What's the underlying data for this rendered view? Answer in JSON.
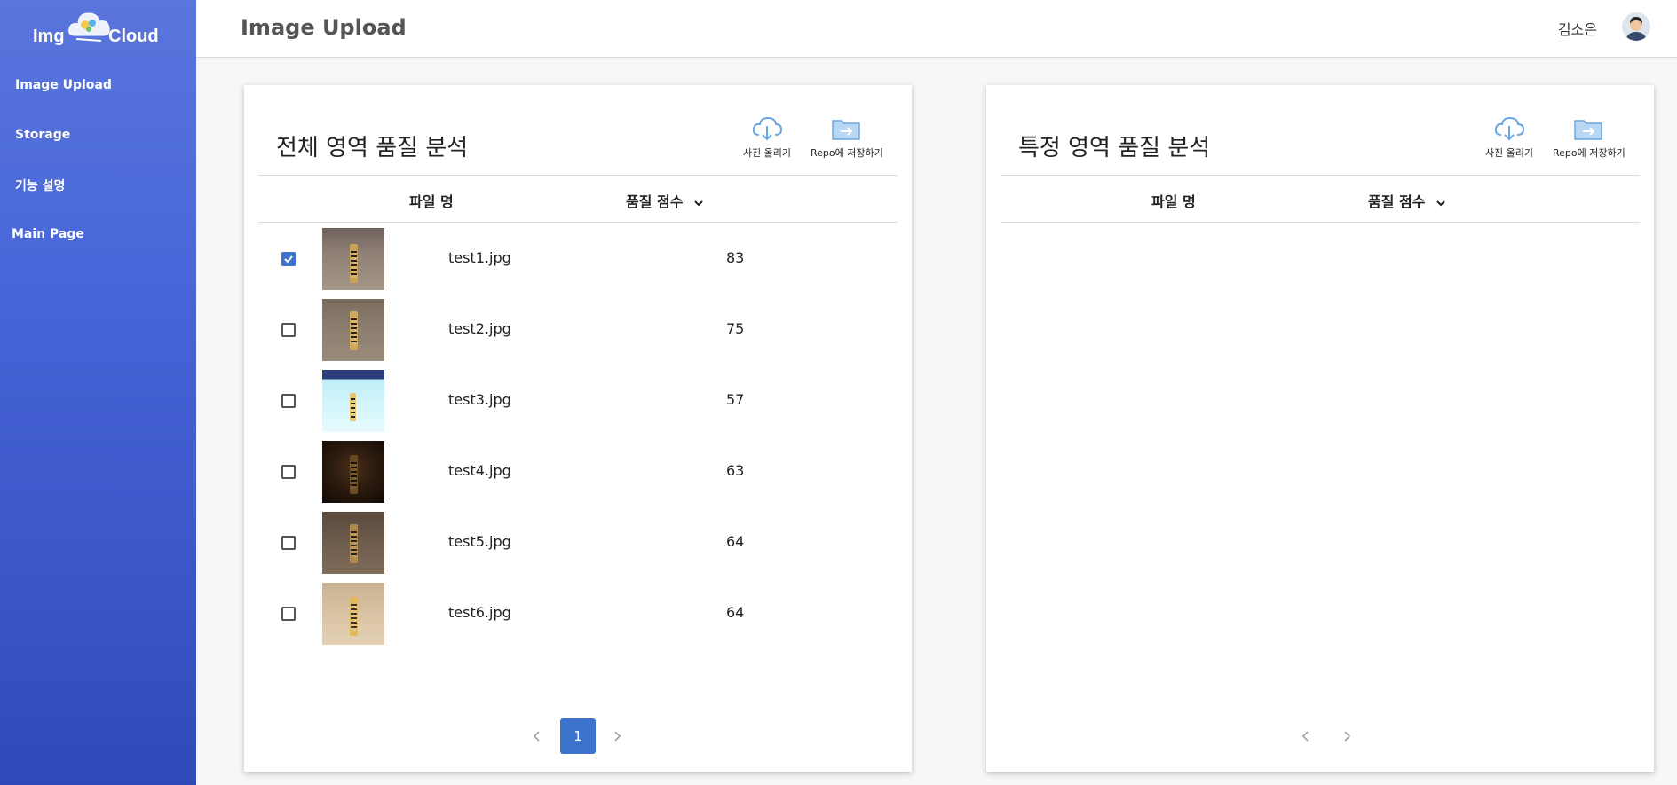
{
  "app": {
    "logo_left": "Img",
    "logo_right": "Cloud"
  },
  "sidebar": {
    "items": [
      {
        "label": "Image Upload"
      },
      {
        "label": "Storage"
      },
      {
        "label": "기능 설명"
      },
      {
        "label": "Main Page"
      }
    ]
  },
  "header": {
    "title": "Image Upload",
    "user_name": "김소은"
  },
  "left_panel": {
    "title": "전체 영역 품질 분석",
    "upload_label": "사진 올리기",
    "save_label": "Repo에 저장하기",
    "col_filename": "파일 명",
    "col_score": "품질 점수",
    "rows": [
      {
        "file": "test1.jpg",
        "score": "83",
        "checked": true,
        "thumb_color": "#8a7a70"
      },
      {
        "file": "test2.jpg",
        "score": "75",
        "checked": false,
        "thumb_color": "#8c7e6e"
      },
      {
        "file": "test3.jpg",
        "score": "57",
        "checked": false,
        "thumb_color": "#c8f0f6"
      },
      {
        "file": "test4.jpg",
        "score": "63",
        "checked": false,
        "thumb_color": "#2a1a10"
      },
      {
        "file": "test5.jpg",
        "score": "64",
        "checked": false,
        "thumb_color": "#6e5a4a"
      },
      {
        "file": "test6.jpg",
        "score": "64",
        "checked": false,
        "thumb_color": "#d9c3a4"
      }
    ],
    "page": "1"
  },
  "right_panel": {
    "title": "특정 영역 품질 분석",
    "upload_label": "사진 올리기",
    "save_label": "Repo에 저장하기",
    "col_filename": "파일 명",
    "col_score": "품질 점수"
  },
  "colors": {
    "accent": "#3d73cc",
    "sidebar_top": "#5a76dd",
    "sidebar_bottom": "#3049b8"
  }
}
